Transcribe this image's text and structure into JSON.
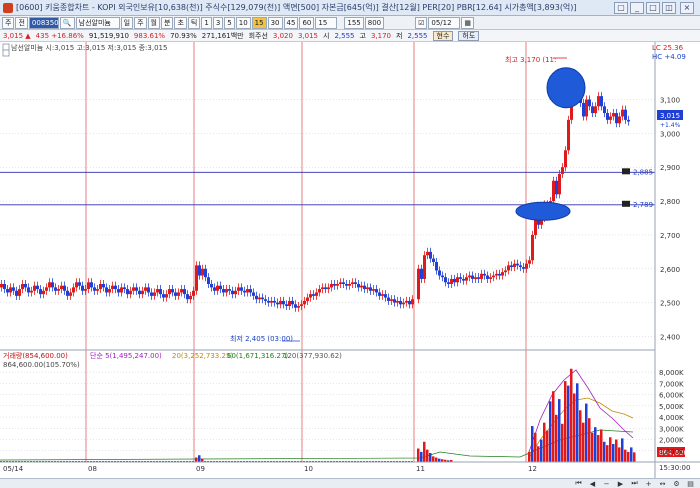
{
  "window": {
    "title": "[0600] 키움종합차트 - KOPI 외국인보유[10,638(천)] 주식수[129,079(천)] 액면[500] 자본금[645(억)] 결산[12월] PER[20] PBR[12.64] 시가총액[3,893(억)] 유통비율[59.9]"
  },
  "toolbar": {
    "items": [
      "주",
      "전",
      "",
      "남선알미늄",
      "일",
      "주",
      "월",
      "분",
      "초",
      "틱",
      "1",
      "3",
      "5",
      "10",
      "15",
      "30",
      "45",
      "60",
      "15",
      "155",
      "800",
      "",
      "",
      "05/12"
    ],
    "code_value": "008350",
    "active_item": "15"
  },
  "quote": {
    "price": "3,015 ▲",
    "change": "435 +16.86%",
    "volume": "91,519,910",
    "ratio": "983.61%",
    "pct": "70.93%",
    "amount": "271,161백만",
    "turnover": "회주선",
    "v1": "3,020",
    "v2": "3,015",
    "open_label": "시",
    "open": "2,555",
    "high_label": "고",
    "high": "3,170",
    "low_label": "저",
    "low": "2,555",
    "btn1": "현수",
    "btn2": "허도"
  },
  "chart_data": {
    "type": "candlestick",
    "price_title": "남선알미늄 시:3,015 고:3,015 저:3,015 종:3,015",
    "volume_title": "거래량(854,600.00)",
    "volume_ma_labels": [
      "단순 5(1,495,247.00)",
      "20(3,252,733.25)",
      "60(1,671,316.27)",
      "120(377,930.62)"
    ],
    "volume_sub": "864,600.00(105.70%)",
    "price_ticks": [
      "3,100",
      "3,000",
      "2,900",
      "2,800",
      "2,700",
      "2,600",
      "2,500",
      "2,400"
    ],
    "volume_ticks": [
      "8,000K",
      "7,000K",
      "6,000K",
      "5,000K",
      "4,000K",
      "3,000K",
      "2,000K",
      "1,000K"
    ],
    "x_ticks": [
      "05/14",
      "08",
      "09",
      "10",
      "11",
      "12"
    ],
    "hlines": [
      "2,885",
      "2,789"
    ],
    "high_annotation": "최고 3,170 (11:",
    "low_annotation": "최저 2,405 (03:00)",
    "top_right_labels": [
      "LC 25.36",
      "HC +4.09"
    ],
    "current_price_label": "3,015",
    "current_price_change": "+1.4%",
    "current_volume_label": "864,600",
    "time_label": "15:30:00"
  },
  "colors": {
    "up": "#e0191b",
    "down": "#1f3fd6",
    "grid": "#c8ccd4",
    "session": "#e06060",
    "hline": "#2a2ab0",
    "circle": "#1f5ad8"
  }
}
